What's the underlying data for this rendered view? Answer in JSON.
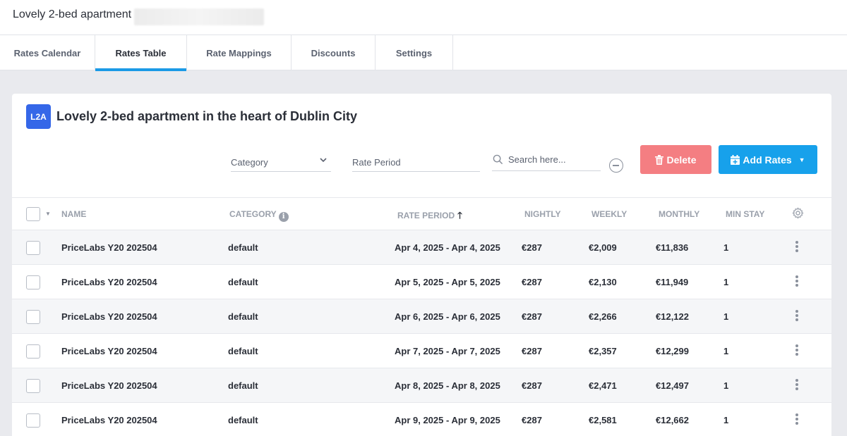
{
  "app": {
    "title": "Lovely 2-bed apartment"
  },
  "tabs": [
    {
      "label": "Rates Calendar"
    },
    {
      "label": "Rates Table"
    },
    {
      "label": "Rate Mappings"
    },
    {
      "label": "Discounts"
    },
    {
      "label": "Settings"
    }
  ],
  "property": {
    "badge": "L2A",
    "title": "Lovely 2-bed apartment in the heart of Dublin City"
  },
  "filters": {
    "category_label": "Category",
    "rate_period_label": "Rate Period",
    "search_placeholder": "Search here..."
  },
  "actions": {
    "delete_label": "Delete",
    "add_rates_label": "Add Rates"
  },
  "table": {
    "headers": {
      "name": "NAME",
      "category": "CATEGORY",
      "rate_period": "RATE PERIOD",
      "nightly": "NIGHTLY",
      "weekly": "WEEKLY",
      "monthly": "MONTHLY",
      "min_stay": "MIN STAY"
    },
    "rows": [
      {
        "name": "PriceLabs Y20 202504",
        "category": "default",
        "rate_period": "Apr 4, 2025 - Apr 4, 2025",
        "nightly": "€287",
        "weekly": "€2,009",
        "monthly": "€11,836",
        "min_stay": "1"
      },
      {
        "name": "PriceLabs Y20 202504",
        "category": "default",
        "rate_period": "Apr 5, 2025 - Apr 5, 2025",
        "nightly": "€287",
        "weekly": "€2,130",
        "monthly": "€11,949",
        "min_stay": "1"
      },
      {
        "name": "PriceLabs Y20 202504",
        "category": "default",
        "rate_period": "Apr 6, 2025 - Apr 6, 2025",
        "nightly": "€287",
        "weekly": "€2,266",
        "monthly": "€12,122",
        "min_stay": "1"
      },
      {
        "name": "PriceLabs Y20 202504",
        "category": "default",
        "rate_period": "Apr 7, 2025 - Apr 7, 2025",
        "nightly": "€287",
        "weekly": "€2,357",
        "monthly": "€12,299",
        "min_stay": "1"
      },
      {
        "name": "PriceLabs Y20 202504",
        "category": "default",
        "rate_period": "Apr 8, 2025 - Apr 8, 2025",
        "nightly": "€287",
        "weekly": "€2,471",
        "monthly": "€12,497",
        "min_stay": "1"
      },
      {
        "name": "PriceLabs Y20 202504",
        "category": "default",
        "rate_period": "Apr 9, 2025 - Apr 9, 2025",
        "nightly": "€287",
        "weekly": "€2,581",
        "monthly": "€12,662",
        "min_stay": "1"
      }
    ]
  },
  "colors": {
    "accent": "#1a9ae6",
    "delete": "#f47e82",
    "add": "#17a1eb",
    "badge": "#3567e8"
  },
  "icons": {
    "search": "search-icon",
    "trash": "trash-icon",
    "calendar_plus": "calendar-plus-icon",
    "gear": "gear-icon",
    "kebab": "more-vertical-icon",
    "info": "info-icon",
    "sort": "arrow-up-icon"
  }
}
